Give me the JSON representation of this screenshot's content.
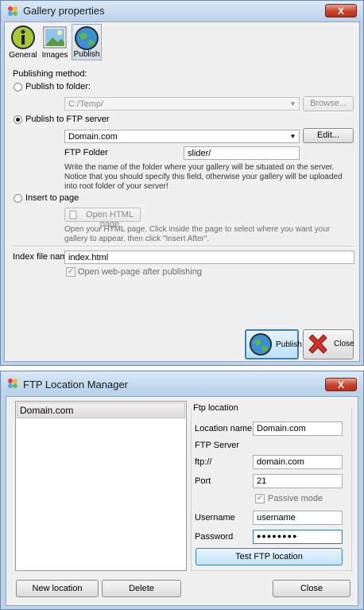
{
  "gallery": {
    "title": "Gallery properties",
    "close_symbol": "X",
    "tabs": [
      "General",
      "Images",
      "Publish"
    ],
    "publishing_method_label": "Publishing method:",
    "publish_to_folder_label": "Publish to folder:",
    "folder_value": "C:/Temp/",
    "browse_label": "Browse...",
    "publish_to_ftp_label": "Publish to FTP server",
    "ftp_server_value": "Domain.com",
    "edit_label": "Edit...",
    "ftp_folder_label": "FTP Folder",
    "ftp_folder_value": "slider/",
    "ftp_note": "Write the name of the folder where your gallery will be situated on the server. Notice that you should specify this field, otherwise your gallery will be uploaded into root folder of your server!",
    "insert_to_page_label": "Insert to page",
    "open_html_label": "Open HTML page",
    "insert_note": "Open your HTML page. Click inside the page to select where you want your gallery to appear, then click \"Insert After\".",
    "index_file_label": "Index file name",
    "index_file_value": "index.html",
    "open_after_label": "Open web-page after publishing",
    "publish_button": "Publish",
    "close_button": "Close"
  },
  "ftp_manager": {
    "title": "FTP Location Manager",
    "close_symbol": "X",
    "locations": [
      "Domain.com"
    ],
    "ftp_location_heading": "Ftp location",
    "location_name_label": "Location name",
    "location_name_value": "Domain.com",
    "ftp_server_heading": "FTP Server",
    "ftp_prefix_label": "ftp://",
    "server_value": "domain.com",
    "port_label": "Port",
    "port_value": "21",
    "passive_mode_label": "Passive mode",
    "username_label": "Username",
    "username_value": "username",
    "password_label": "Password",
    "password_value": "●●●●●●●●",
    "test_button": "Test FTP location",
    "new_location_button": "New location",
    "delete_button": "Delete",
    "close_button": "Close"
  }
}
